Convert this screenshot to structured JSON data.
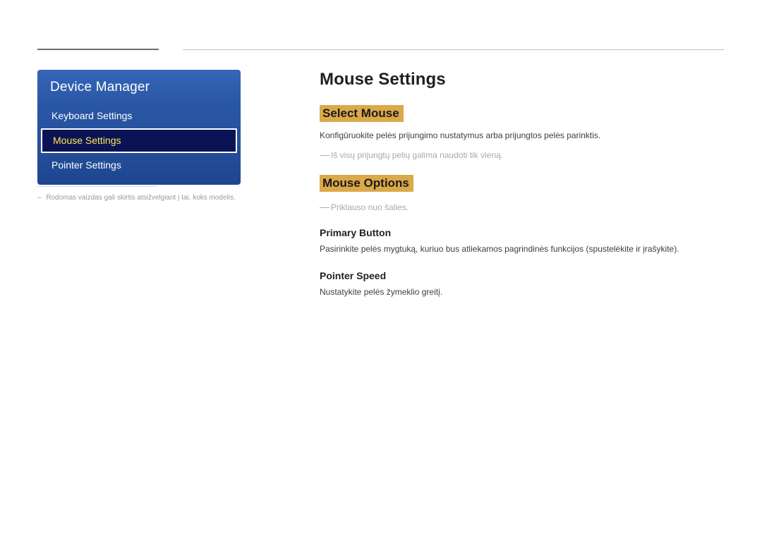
{
  "panel": {
    "title": "Device Manager",
    "items": [
      {
        "label": "Keyboard Settings",
        "selected": false
      },
      {
        "label": "Mouse Settings",
        "selected": true
      },
      {
        "label": "Pointer Settings",
        "selected": false
      }
    ]
  },
  "footnote": {
    "text": "Rodomas vaizdas gali skirtis atsižvelgiant į tai, koks modelis."
  },
  "content": {
    "title": "Mouse Settings",
    "sections": [
      {
        "heading": "Select Mouse",
        "body": "Konfigūruokite pelės prijungimo nustatymus arba prijungtos pelės parinktis.",
        "note": "Iš visų prijungtų pelių galima naudoti tik vieną."
      },
      {
        "heading": "Mouse Options",
        "note": "Priklauso nuo šalies.",
        "subsections": [
          {
            "title": "Primary Button",
            "body": "Pasirinkite pelės mygtuką, kuriuo bus atliekamos pagrindinės funkcijos (spustelėkite ir įrašykite)."
          },
          {
            "title": "Pointer Speed",
            "body": "Nustatykite pelės žymeklio greitį."
          }
        ]
      }
    ]
  }
}
